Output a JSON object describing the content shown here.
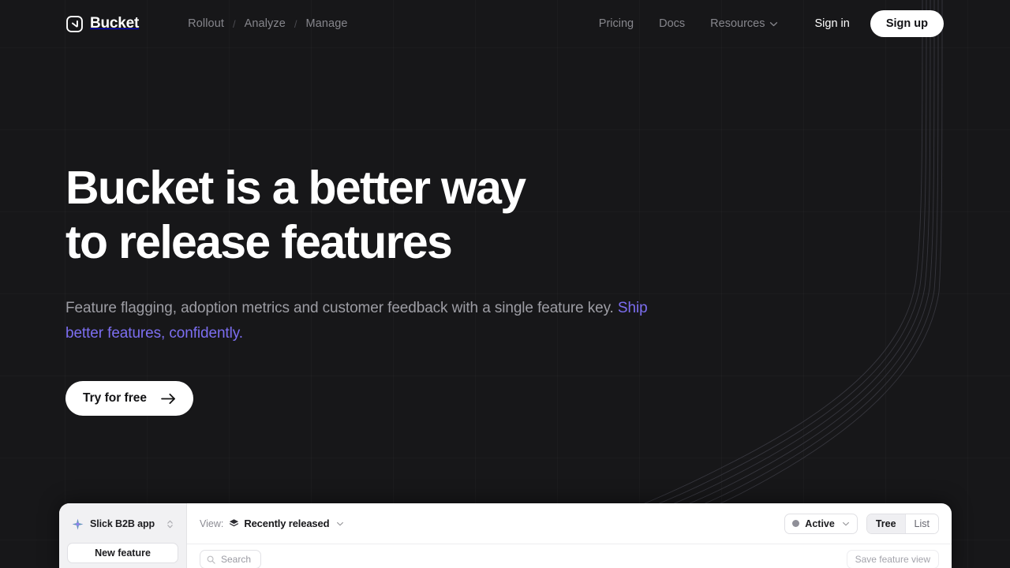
{
  "theme": {
    "background": "#171719",
    "accent_purple": "#7c6ef0",
    "text_primary": "#ffffff",
    "text_muted": "#9d9da4",
    "nav_muted": "#86868c",
    "panel_bg": "#ffffff",
    "panel_sidebar_bg": "#f1f1f3"
  },
  "nav": {
    "brand": {
      "name": "Bucket",
      "icon": "bucket-logo-icon"
    },
    "primary_links": [
      {
        "label": "Rollout"
      },
      {
        "label": "Analyze"
      },
      {
        "label": "Manage"
      }
    ],
    "separator": "/",
    "secondary_links": [
      {
        "label": "Pricing"
      },
      {
        "label": "Docs"
      },
      {
        "label": "Resources",
        "icon": "chevron-down-icon",
        "has_dropdown": true
      }
    ],
    "sign_in_label": "Sign in",
    "sign_up_label": "Sign up"
  },
  "hero": {
    "headline": "Bucket is a better way\nto release features",
    "subtext_plain": "Feature flagging, adoption metrics and customer feedback with a single feature key. ",
    "subtext_accent": "Ship better features, confidently.",
    "cta_label": "Try for free",
    "cta_icon": "arrow-right-icon"
  },
  "app_preview": {
    "sidebar": {
      "app_name": "Slick B2B app",
      "app_icon": "sparkle-star-icon",
      "switcher_icon": "up-down-chevron-icon",
      "new_feature_label": "New feature"
    },
    "toolbar": {
      "view_label": "View:",
      "view_icon": "stack-layers-icon",
      "view_value": "Recently released",
      "view_chevron_icon": "chevron-down-icon",
      "status_filter": {
        "label": "Active",
        "dot_color": "#8f8f98",
        "chevron_icon": "chevron-down-icon"
      },
      "display_modes": [
        {
          "label": "Tree",
          "active": true
        },
        {
          "label": "List",
          "active": false
        }
      ]
    },
    "subbar": {
      "search_placeholder": "Search",
      "search_icon": "search-icon",
      "save_view_label": "Save feature view"
    }
  }
}
